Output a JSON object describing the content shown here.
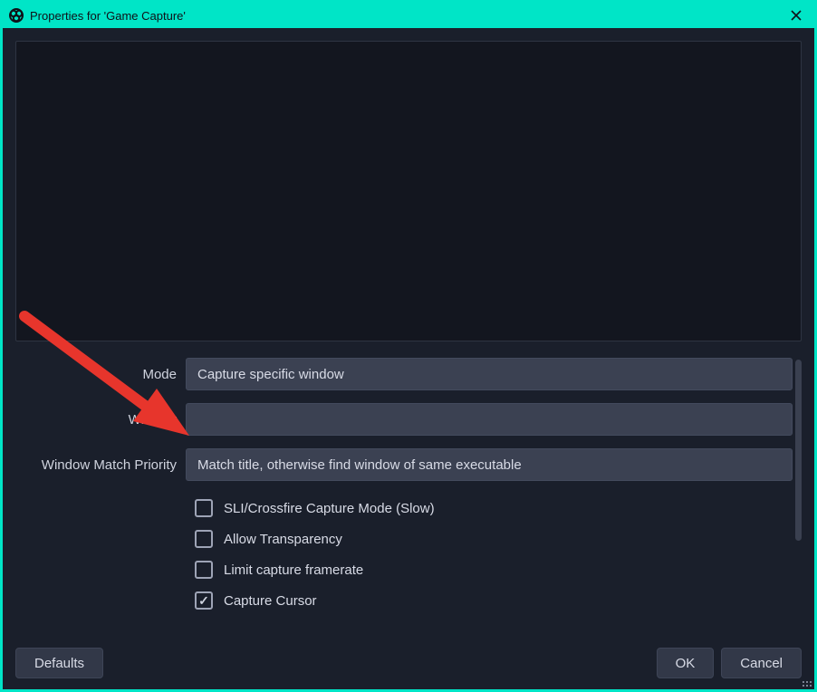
{
  "titlebar": {
    "title": "Properties for 'Game Capture'"
  },
  "form": {
    "mode": {
      "label": "Mode",
      "value": "Capture specific window"
    },
    "window": {
      "label": "Window",
      "value": ""
    },
    "match": {
      "label": "Window Match Priority",
      "value": "Match title, otherwise find window of same executable"
    }
  },
  "checks": {
    "sli": {
      "label": "SLI/Crossfire Capture Mode (Slow)",
      "checked": false
    },
    "transparency": {
      "label": "Allow Transparency",
      "checked": false
    },
    "limit": {
      "label": "Limit capture framerate",
      "checked": false
    },
    "cursor": {
      "label": "Capture Cursor",
      "checked": true
    }
  },
  "buttons": {
    "defaults": "Defaults",
    "ok": "OK",
    "cancel": "Cancel"
  }
}
